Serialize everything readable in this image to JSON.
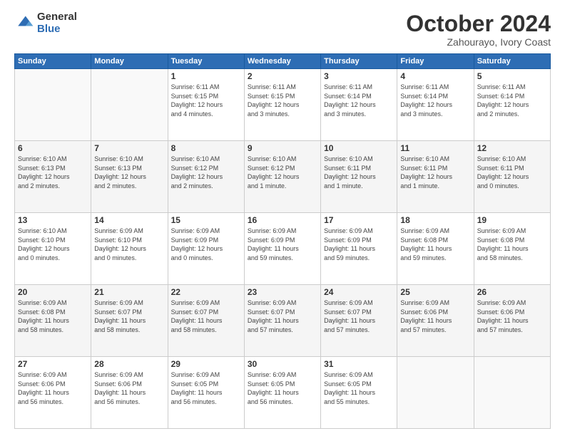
{
  "logo": {
    "general": "General",
    "blue": "Blue"
  },
  "header": {
    "month": "October 2024",
    "location": "Zahourayo, Ivory Coast"
  },
  "weekdays": [
    "Sunday",
    "Monday",
    "Tuesday",
    "Wednesday",
    "Thursday",
    "Friday",
    "Saturday"
  ],
  "weeks": [
    [
      {
        "day": "",
        "info": ""
      },
      {
        "day": "",
        "info": ""
      },
      {
        "day": "1",
        "info": "Sunrise: 6:11 AM\nSunset: 6:15 PM\nDaylight: 12 hours\nand 4 minutes."
      },
      {
        "day": "2",
        "info": "Sunrise: 6:11 AM\nSunset: 6:15 PM\nDaylight: 12 hours\nand 3 minutes."
      },
      {
        "day": "3",
        "info": "Sunrise: 6:11 AM\nSunset: 6:14 PM\nDaylight: 12 hours\nand 3 minutes."
      },
      {
        "day": "4",
        "info": "Sunrise: 6:11 AM\nSunset: 6:14 PM\nDaylight: 12 hours\nand 3 minutes."
      },
      {
        "day": "5",
        "info": "Sunrise: 6:11 AM\nSunset: 6:14 PM\nDaylight: 12 hours\nand 2 minutes."
      }
    ],
    [
      {
        "day": "6",
        "info": "Sunrise: 6:10 AM\nSunset: 6:13 PM\nDaylight: 12 hours\nand 2 minutes."
      },
      {
        "day": "7",
        "info": "Sunrise: 6:10 AM\nSunset: 6:13 PM\nDaylight: 12 hours\nand 2 minutes."
      },
      {
        "day": "8",
        "info": "Sunrise: 6:10 AM\nSunset: 6:12 PM\nDaylight: 12 hours\nand 2 minutes."
      },
      {
        "day": "9",
        "info": "Sunrise: 6:10 AM\nSunset: 6:12 PM\nDaylight: 12 hours\nand 1 minute."
      },
      {
        "day": "10",
        "info": "Sunrise: 6:10 AM\nSunset: 6:11 PM\nDaylight: 12 hours\nand 1 minute."
      },
      {
        "day": "11",
        "info": "Sunrise: 6:10 AM\nSunset: 6:11 PM\nDaylight: 12 hours\nand 1 minute."
      },
      {
        "day": "12",
        "info": "Sunrise: 6:10 AM\nSunset: 6:11 PM\nDaylight: 12 hours\nand 0 minutes."
      }
    ],
    [
      {
        "day": "13",
        "info": "Sunrise: 6:10 AM\nSunset: 6:10 PM\nDaylight: 12 hours\nand 0 minutes."
      },
      {
        "day": "14",
        "info": "Sunrise: 6:09 AM\nSunset: 6:10 PM\nDaylight: 12 hours\nand 0 minutes."
      },
      {
        "day": "15",
        "info": "Sunrise: 6:09 AM\nSunset: 6:09 PM\nDaylight: 12 hours\nand 0 minutes."
      },
      {
        "day": "16",
        "info": "Sunrise: 6:09 AM\nSunset: 6:09 PM\nDaylight: 11 hours\nand 59 minutes."
      },
      {
        "day": "17",
        "info": "Sunrise: 6:09 AM\nSunset: 6:09 PM\nDaylight: 11 hours\nand 59 minutes."
      },
      {
        "day": "18",
        "info": "Sunrise: 6:09 AM\nSunset: 6:08 PM\nDaylight: 11 hours\nand 59 minutes."
      },
      {
        "day": "19",
        "info": "Sunrise: 6:09 AM\nSunset: 6:08 PM\nDaylight: 11 hours\nand 58 minutes."
      }
    ],
    [
      {
        "day": "20",
        "info": "Sunrise: 6:09 AM\nSunset: 6:08 PM\nDaylight: 11 hours\nand 58 minutes."
      },
      {
        "day": "21",
        "info": "Sunrise: 6:09 AM\nSunset: 6:07 PM\nDaylight: 11 hours\nand 58 minutes."
      },
      {
        "day": "22",
        "info": "Sunrise: 6:09 AM\nSunset: 6:07 PM\nDaylight: 11 hours\nand 58 minutes."
      },
      {
        "day": "23",
        "info": "Sunrise: 6:09 AM\nSunset: 6:07 PM\nDaylight: 11 hours\nand 57 minutes."
      },
      {
        "day": "24",
        "info": "Sunrise: 6:09 AM\nSunset: 6:07 PM\nDaylight: 11 hours\nand 57 minutes."
      },
      {
        "day": "25",
        "info": "Sunrise: 6:09 AM\nSunset: 6:06 PM\nDaylight: 11 hours\nand 57 minutes."
      },
      {
        "day": "26",
        "info": "Sunrise: 6:09 AM\nSunset: 6:06 PM\nDaylight: 11 hours\nand 57 minutes."
      }
    ],
    [
      {
        "day": "27",
        "info": "Sunrise: 6:09 AM\nSunset: 6:06 PM\nDaylight: 11 hours\nand 56 minutes."
      },
      {
        "day": "28",
        "info": "Sunrise: 6:09 AM\nSunset: 6:06 PM\nDaylight: 11 hours\nand 56 minutes."
      },
      {
        "day": "29",
        "info": "Sunrise: 6:09 AM\nSunset: 6:05 PM\nDaylight: 11 hours\nand 56 minutes."
      },
      {
        "day": "30",
        "info": "Sunrise: 6:09 AM\nSunset: 6:05 PM\nDaylight: 11 hours\nand 56 minutes."
      },
      {
        "day": "31",
        "info": "Sunrise: 6:09 AM\nSunset: 6:05 PM\nDaylight: 11 hours\nand 55 minutes."
      },
      {
        "day": "",
        "info": ""
      },
      {
        "day": "",
        "info": ""
      }
    ]
  ]
}
